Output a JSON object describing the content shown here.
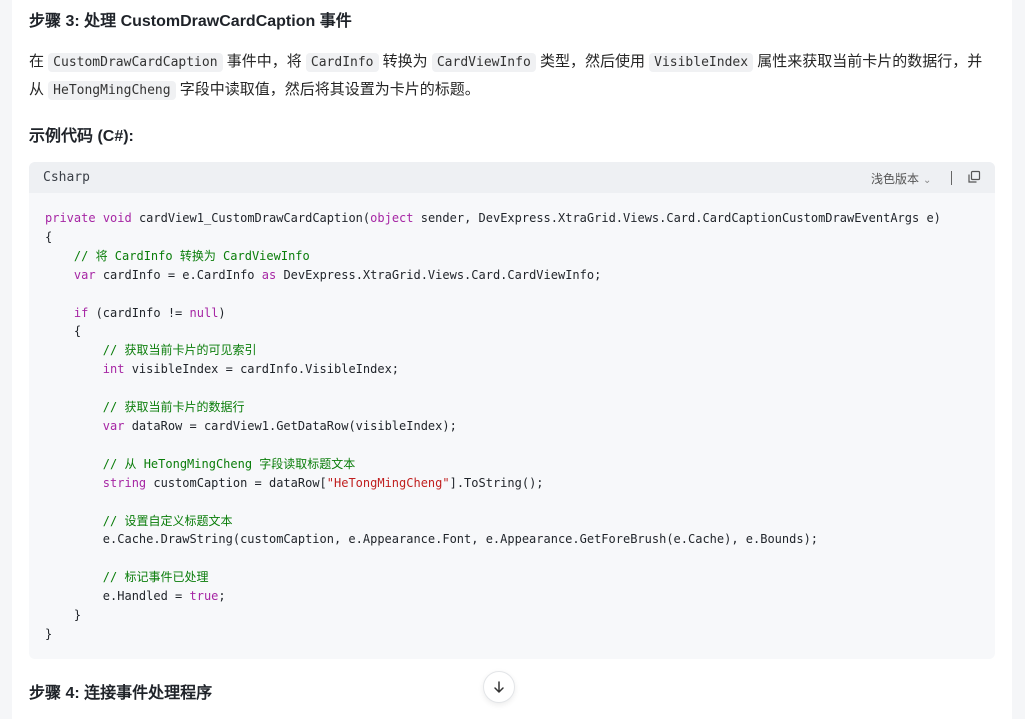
{
  "step3_title": "步骤 3: 处理 CustomDrawCardCaption 事件",
  "paragraph": {
    "p1": "在 ",
    "c1": "CustomDrawCardCaption",
    "p2": " 事件中，将 ",
    "c2": "CardInfo",
    "p3": " 转换为 ",
    "c3": "CardViewInfo",
    "p4": " 类型，然后使用 ",
    "c4": "VisibleIndex",
    "p5": " 属性来获取当前卡片的数据行，并从 ",
    "c5": "HeTongMingCheng",
    "p6": " 字段中读取值，然后将其设置为卡片的标题。"
  },
  "sample_title": "示例代码 (C#):",
  "code_block": {
    "language": "Csharp",
    "theme_label": "浅色版本",
    "lines": [
      [
        [
          "kw",
          "private"
        ],
        [
          "t",
          " "
        ],
        [
          "kw",
          "void"
        ],
        [
          "t",
          " cardView1_CustomDrawCardCaption("
        ],
        [
          "kw",
          "object"
        ],
        [
          "t",
          " sender, DevExpress.XtraGrid.Views.Card.CardCaptionCustomDrawEventArgs e)"
        ]
      ],
      [
        [
          "t",
          "{"
        ]
      ],
      [
        [
          "t",
          "    "
        ],
        [
          "cm",
          "// 将 CardInfo 转换为 CardViewInfo"
        ]
      ],
      [
        [
          "t",
          "    "
        ],
        [
          "kw",
          "var"
        ],
        [
          "t",
          " cardInfo = e.CardInfo "
        ],
        [
          "kw",
          "as"
        ],
        [
          "t",
          " DevExpress.XtraGrid.Views.Card.CardViewInfo;"
        ]
      ],
      [
        [
          "t",
          ""
        ]
      ],
      [
        [
          "t",
          "    "
        ],
        [
          "kw",
          "if"
        ],
        [
          "t",
          " (cardInfo != "
        ],
        [
          "kw",
          "null"
        ],
        [
          "t",
          ")"
        ]
      ],
      [
        [
          "t",
          "    {"
        ]
      ],
      [
        [
          "t",
          "        "
        ],
        [
          "cm",
          "// 获取当前卡片的可见索引"
        ]
      ],
      [
        [
          "t",
          "        "
        ],
        [
          "kw",
          "int"
        ],
        [
          "t",
          " visibleIndex = cardInfo.VisibleIndex;"
        ]
      ],
      [
        [
          "t",
          ""
        ]
      ],
      [
        [
          "t",
          "        "
        ],
        [
          "cm",
          "// 获取当前卡片的数据行"
        ]
      ],
      [
        [
          "t",
          "        "
        ],
        [
          "kw",
          "var"
        ],
        [
          "t",
          " dataRow = cardView1.GetDataRow(visibleIndex);"
        ]
      ],
      [
        [
          "t",
          ""
        ]
      ],
      [
        [
          "t",
          "        "
        ],
        [
          "cm",
          "// 从 HeTongMingCheng 字段读取标题文本"
        ]
      ],
      [
        [
          "t",
          "        "
        ],
        [
          "kw",
          "string"
        ],
        [
          "t",
          " customCaption = dataRow["
        ],
        [
          "str",
          "\"HeTongMingCheng\""
        ],
        [
          "t",
          "].ToString();"
        ]
      ],
      [
        [
          "t",
          ""
        ]
      ],
      [
        [
          "t",
          "        "
        ],
        [
          "cm",
          "// 设置自定义标题文本"
        ]
      ],
      [
        [
          "t",
          "        e.Cache.DrawString(customCaption, e.Appearance.Font, e.Appearance.GetForeBrush(e.Cache), e.Bounds);"
        ]
      ],
      [
        [
          "t",
          ""
        ]
      ],
      [
        [
          "t",
          "        "
        ],
        [
          "cm",
          "// 标记事件已处理"
        ]
      ],
      [
        [
          "t",
          "        e.Handled = "
        ],
        [
          "kw",
          "true"
        ],
        [
          "t",
          ";"
        ]
      ],
      [
        [
          "t",
          "    }"
        ]
      ],
      [
        [
          "t",
          "}"
        ]
      ]
    ]
  },
  "step4_title": "步骤 4: 连接事件处理程序",
  "colors": {
    "keyword": "#a626a4",
    "comment": "#0a7d0a",
    "string": "#c01f1f",
    "code_bg": "#f7f8fa",
    "code_header_bg": "#eef0f3"
  },
  "icons": {
    "theme_dropdown": "chevron-down-icon",
    "copy": "copy-icon",
    "scroll_down": "arrow-down-icon"
  }
}
